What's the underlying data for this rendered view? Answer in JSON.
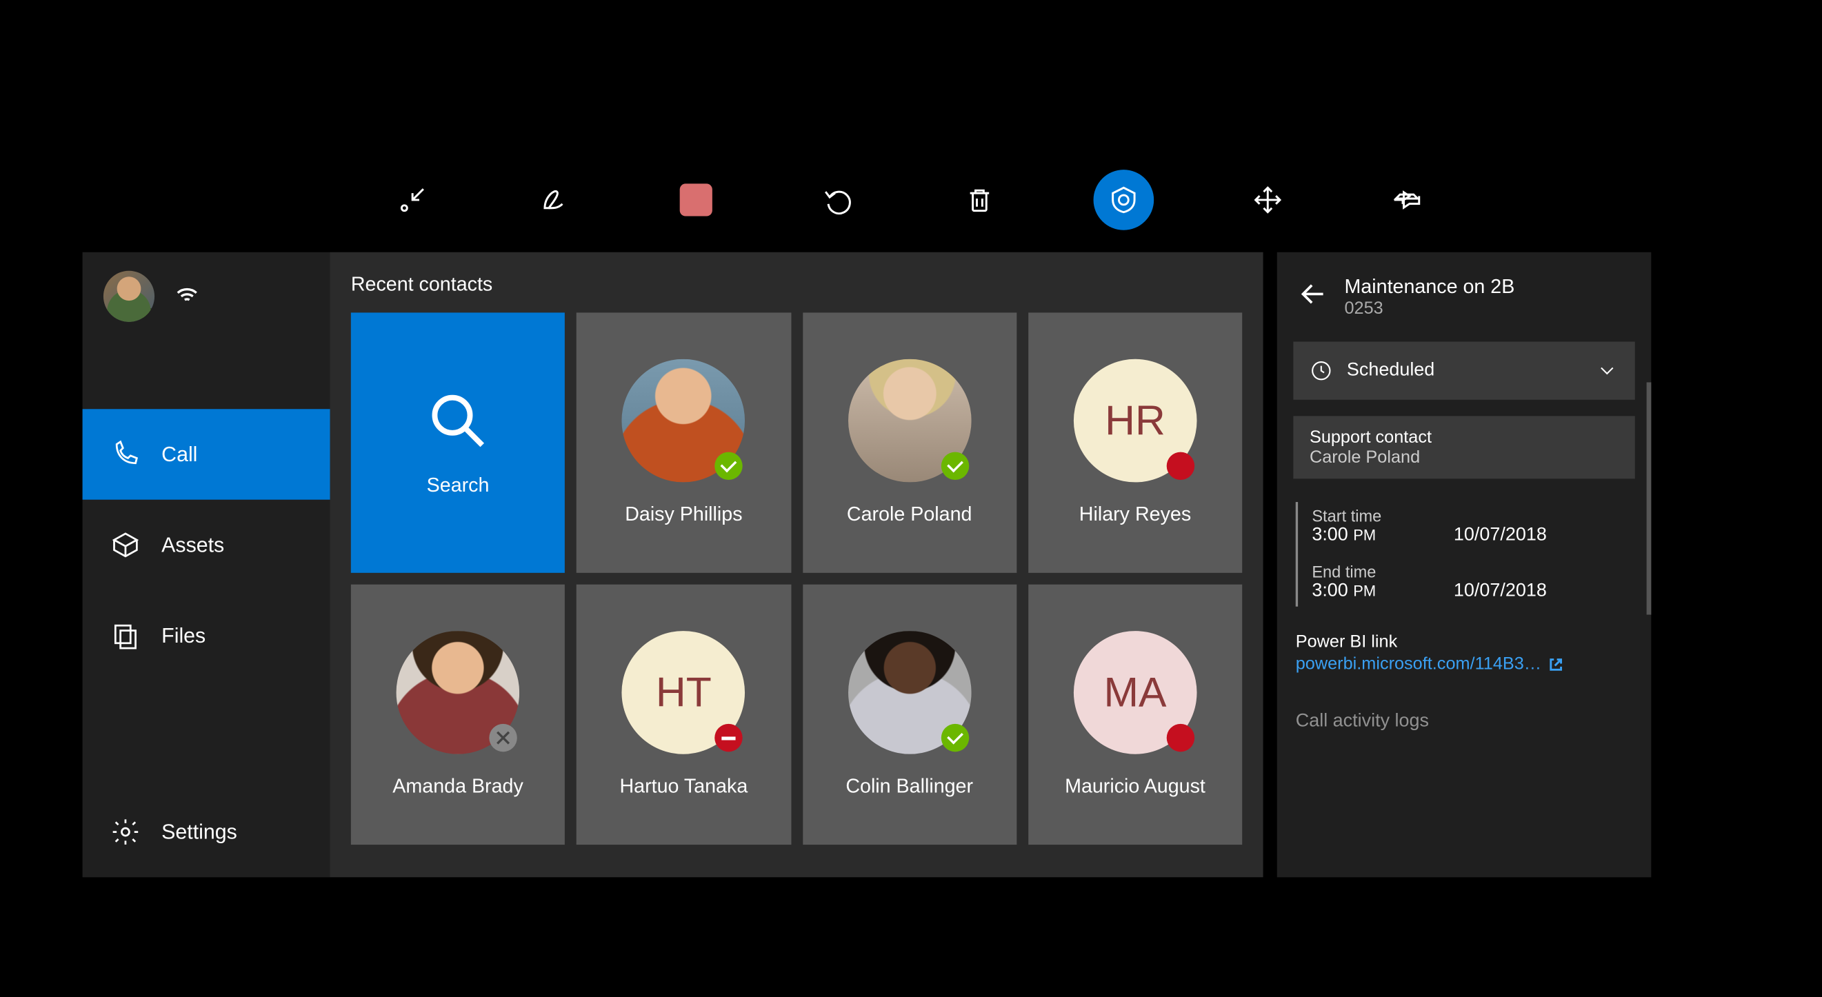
{
  "toolbar": {
    "items": [
      "minimize",
      "ink",
      "stop-record",
      "undo",
      "delete",
      "remote-assist",
      "move",
      "pin"
    ],
    "active_index": 5
  },
  "sidebar": {
    "items": [
      {
        "id": "call",
        "label": "Call",
        "active": true
      },
      {
        "id": "assets",
        "label": "Assets",
        "active": false
      },
      {
        "id": "files",
        "label": "Files",
        "active": false
      }
    ],
    "settings_label": "Settings"
  },
  "main": {
    "title": "Recent contacts",
    "search_label": "Search",
    "contacts": [
      {
        "name": "Daisy Phillips",
        "initials": "",
        "status": "online",
        "photo": "1"
      },
      {
        "name": "Carole Poland",
        "initials": "",
        "status": "online",
        "photo": "2"
      },
      {
        "name": "Hilary Reyes",
        "initials": "HR",
        "status": "busy",
        "photo": ""
      },
      {
        "name": "Amanda Brady",
        "initials": "",
        "status": "offline",
        "photo": "3"
      },
      {
        "name": "Hartuo Tanaka",
        "initials": "HT",
        "status": "dnd",
        "photo": ""
      },
      {
        "name": "Colin Ballinger",
        "initials": "",
        "status": "online",
        "photo": "4"
      },
      {
        "name": "Mauricio August",
        "initials": "MA",
        "status": "busy",
        "photo": "",
        "pink": true
      }
    ]
  },
  "panel": {
    "title": "Maintenance on 2B",
    "id": "0253",
    "status_label": "Scheduled",
    "support_label": "Support contact",
    "support_name": "Carole Poland",
    "start_label": "Start time",
    "start_time": "3:00",
    "start_ampm": "PM",
    "start_date": "10/07/2018",
    "end_label": "End time",
    "end_time": "3:00",
    "end_ampm": "PM",
    "end_date": "10/07/2018",
    "link_label": "Power BI link",
    "link_text": "powerbi.microsoft.com/114B3…",
    "logs_label": "Call activity logs"
  },
  "colors": {
    "accent": "#0078d4"
  }
}
